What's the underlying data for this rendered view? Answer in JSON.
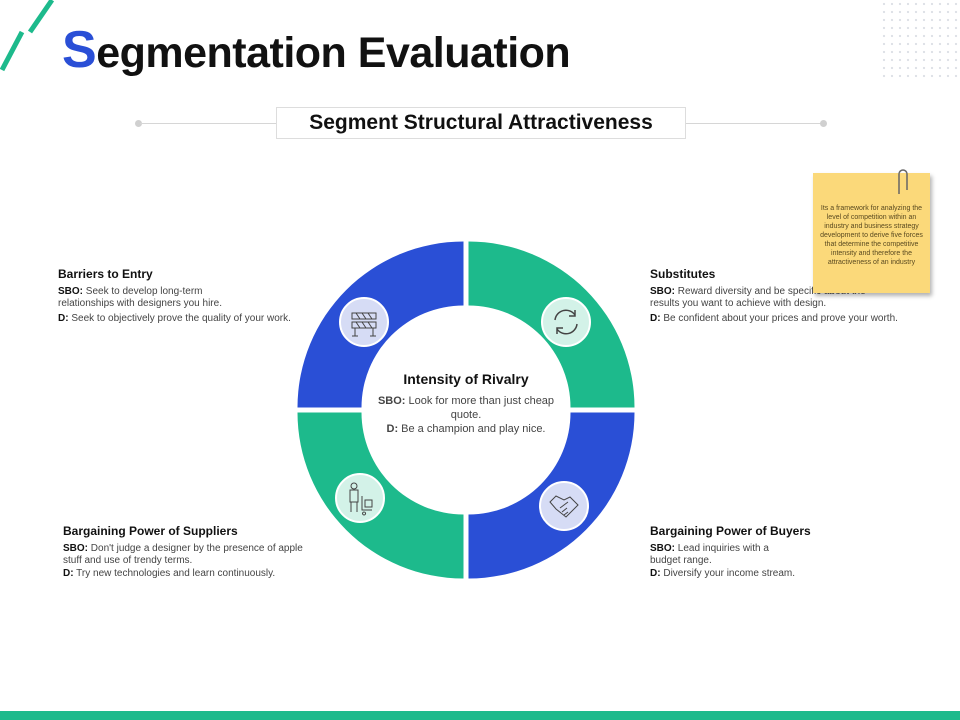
{
  "title": {
    "first_letter": "S",
    "rest": "egmentation Evaluation"
  },
  "subtitle": "Segment Structural Attractiveness",
  "colors": {
    "blue": "#2a4fd6",
    "green": "#1dba8c",
    "note": "#fbd97a"
  },
  "note": {
    "text": "Its a framework for analyzing the level of competition within an industry and business strategy development to derive five forces that determine the competitive intensity and therefore the attractiveness of an industry",
    "icon": "paperclip-icon"
  },
  "center": {
    "title": "Intensity of Rivalry",
    "sbo_label": "SBO:",
    "sbo": "Look for more than just cheap quote.",
    "d_label": "D:",
    "d": "Be a champion and play nice."
  },
  "forces": [
    {
      "title": "Barriers to Entry",
      "sbo_label": "SBO:",
      "sbo": "Seek to develop long-term relationships with  designers you hire.",
      "d_label": "D:",
      "d": "Seek to objectively prove the quality of your work.",
      "icon": "barrier-icon"
    },
    {
      "title": "Substitutes",
      "sbo_label": "SBO:",
      "sbo": "Reward diversity and be specific about the results you want to achieve with design.",
      "d_label": "D:",
      "d": "Be confident about your prices and prove your worth.",
      "icon": "refresh-icon"
    },
    {
      "title": "Bargaining Power of Suppliers",
      "sbo_label": "SBO:",
      "sbo": "Don't judge a designer by the presence of apple stuff and use of trendy terms.",
      "d_label": "D:",
      "d": "Try new technologies and learn continuously.",
      "icon": "supplier-delivery-icon"
    },
    {
      "title": "Bargaining Power of Buyers",
      "sbo_label": "SBO:",
      "sbo": "Lead inquiries with a budget range.",
      "d_label": "D:",
      "d": "Diversify your income stream.",
      "icon": "handshake-icon"
    }
  ]
}
